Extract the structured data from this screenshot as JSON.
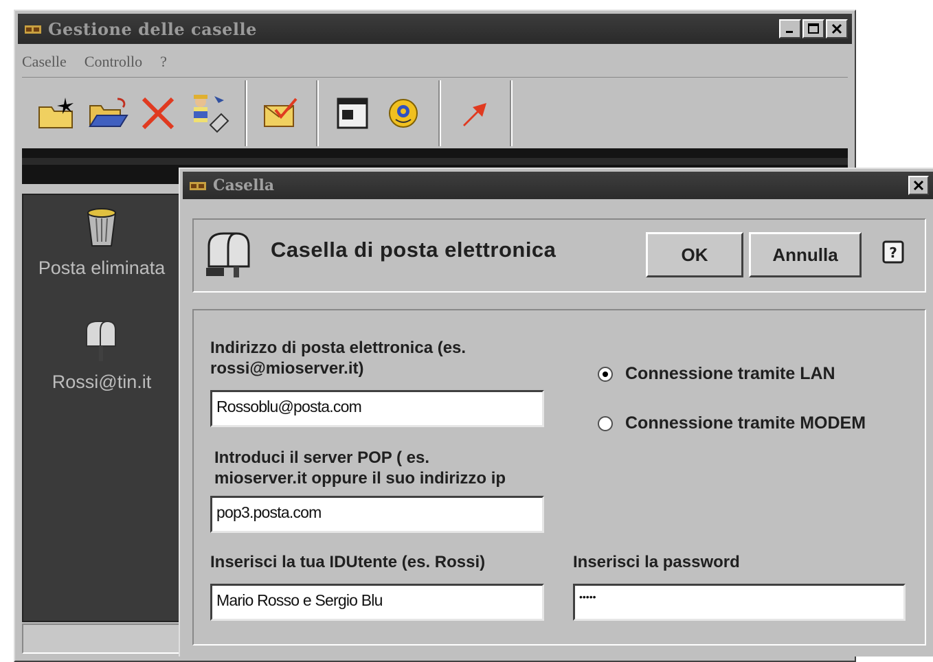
{
  "main_window": {
    "title": "Gestione delle caselle",
    "menu": [
      "Caselle",
      "Controllo",
      "?"
    ],
    "window_buttons": [
      "minimize",
      "maximize",
      "close"
    ],
    "toolbar_icons": [
      "new-mailbox-icon",
      "open-folder-icon",
      "delete-icon",
      "users-config-icon",
      "check-mail-icon",
      "window-icon",
      "help-face-icon",
      "send-arrow-icon"
    ],
    "sidebar": [
      {
        "label": "Posta eliminata",
        "icon": "trash-icon"
      },
      {
        "label": "Rossi@tin.it",
        "icon": "mailbox-icon"
      }
    ]
  },
  "dialog": {
    "title": "Casella",
    "heading": "Casella di posta elettronica",
    "ok_label": "OK",
    "cancel_label": "Annulla",
    "email_label_line1": "Indirizzo di posta elettronica (es.",
    "email_label_line2": "rossi@mioserver.it)",
    "email_value": "Rossoblu@posta.com",
    "pop_label_line1": "Introduci il server POP ( es.",
    "pop_label_line2": "mioserver.it oppure il suo indirizzo ip",
    "pop_value": "pop3.posta.com",
    "user_label": "Inserisci la tua IDUtente (es. Rossi)",
    "user_value": "Mario Rosso e Sergio Blu",
    "password_label": "Inserisci la password",
    "password_value": "•••••",
    "radio_lan_label": "Connessione tramite LAN",
    "radio_modem_label": "Connessione tramite MODEM",
    "selected_connection": "LAN"
  }
}
